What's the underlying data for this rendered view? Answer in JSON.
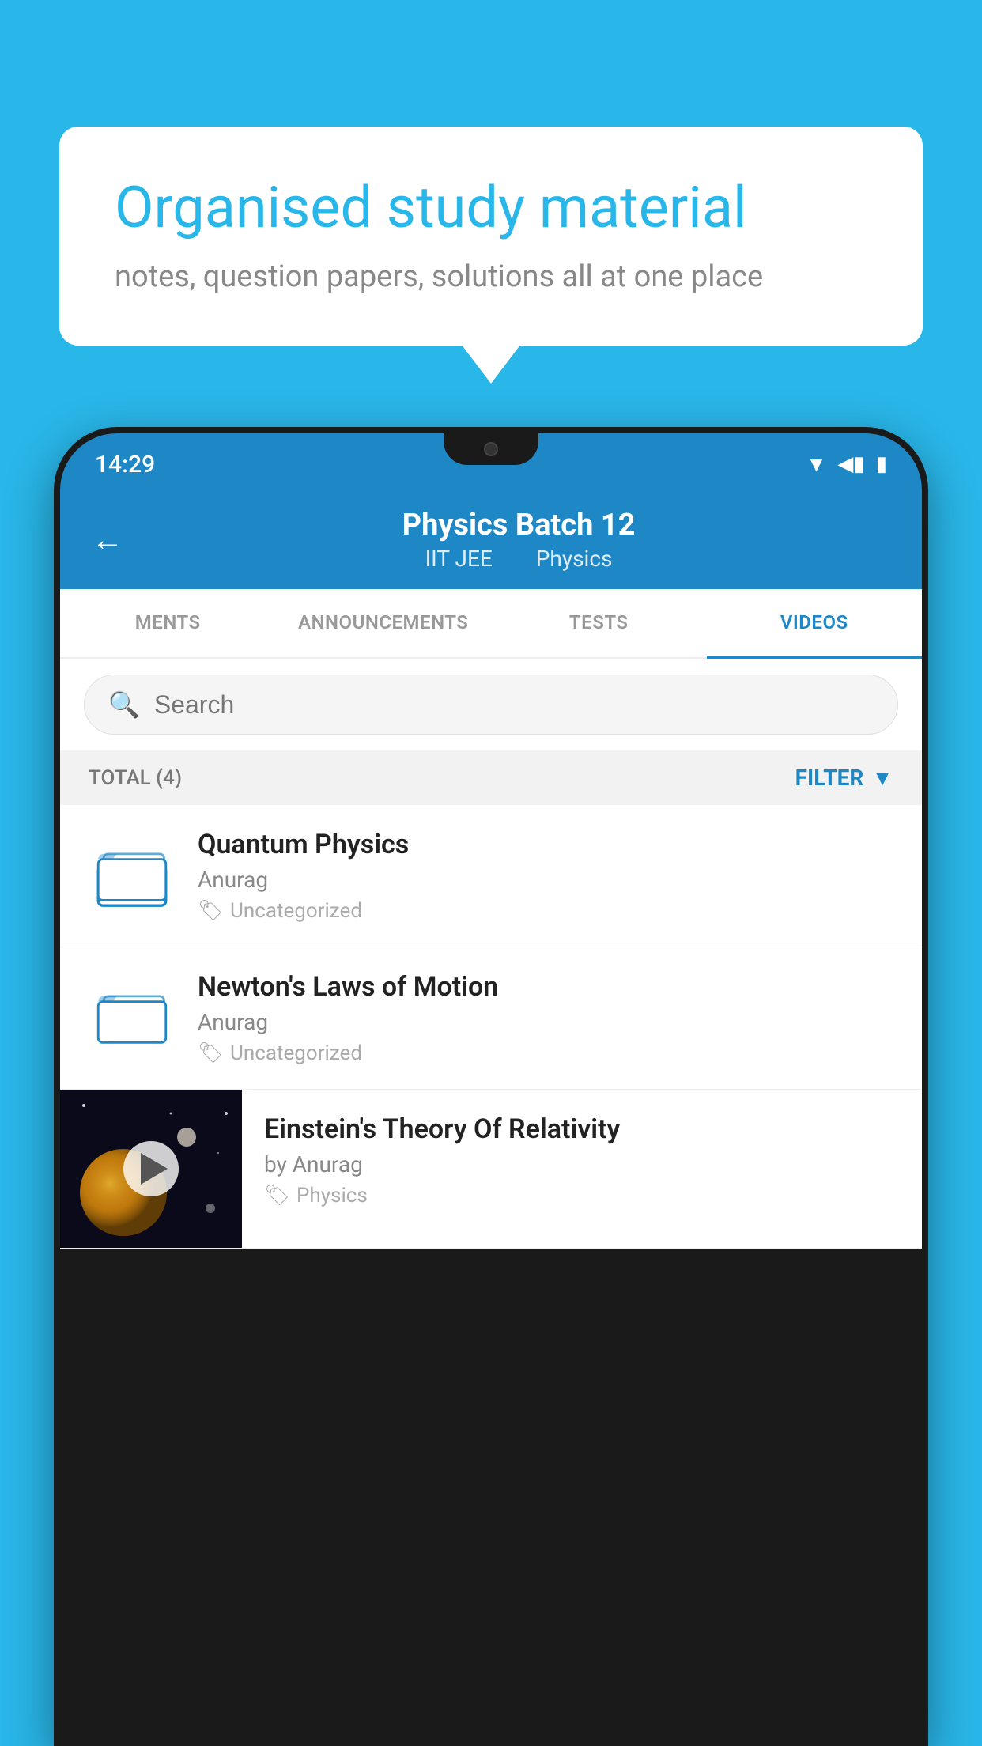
{
  "background": {
    "color": "#29b6e8"
  },
  "speech_bubble": {
    "title": "Organised study material",
    "subtitle": "notes, question papers, solutions all at one place"
  },
  "phone": {
    "status_bar": {
      "time": "14:29",
      "icons": [
        "wifi",
        "signal",
        "battery"
      ]
    },
    "header": {
      "back_label": "←",
      "title": "Physics Batch 12",
      "subtitle_part1": "IIT JEE",
      "subtitle_part2": "Physics"
    },
    "tabs": [
      {
        "label": "MENTS",
        "active": false
      },
      {
        "label": "ANNOUNCEMENTS",
        "active": false
      },
      {
        "label": "TESTS",
        "active": false
      },
      {
        "label": "VIDEOS",
        "active": true
      }
    ],
    "search": {
      "placeholder": "Search"
    },
    "filter_bar": {
      "total_label": "TOTAL (4)",
      "filter_label": "FILTER"
    },
    "videos": [
      {
        "id": 1,
        "title": "Quantum Physics",
        "author": "Anurag",
        "tag": "Uncategorized",
        "type": "folder"
      },
      {
        "id": 2,
        "title": "Newton's Laws of Motion",
        "author": "Anurag",
        "tag": "Uncategorized",
        "type": "folder"
      },
      {
        "id": 3,
        "title": "Einstein's Theory Of Relativity",
        "author": "by Anurag",
        "tag": "Physics",
        "type": "video"
      }
    ]
  }
}
